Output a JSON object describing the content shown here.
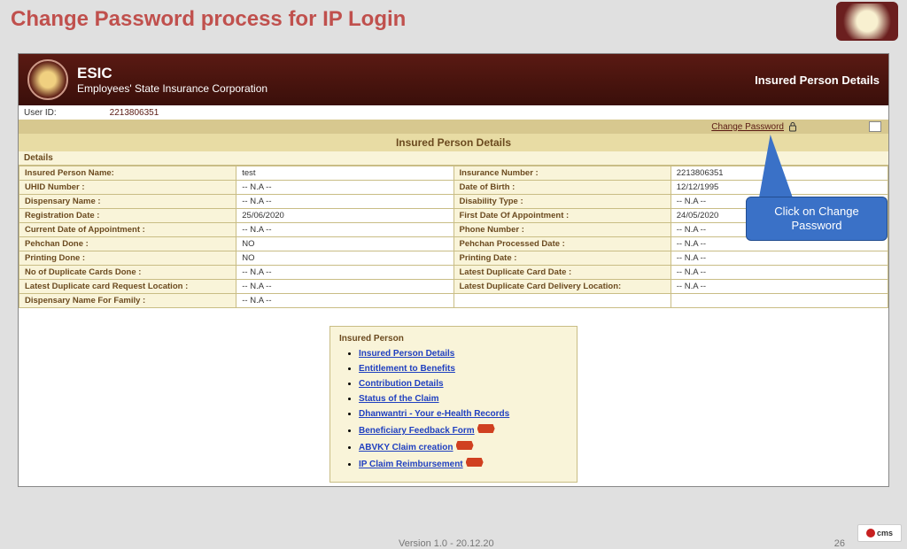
{
  "slide": {
    "title": "Change Password process for IP Login",
    "version": "Version 1.0 - 20.12.20",
    "page": "26",
    "footer_logo": "cms"
  },
  "callout": "Click on Change Password",
  "app": {
    "title1": "ESIC",
    "title2": "Employees' State Insurance Corporation",
    "header_right": "Insured Person Details",
    "userid_label": "User ID:",
    "userid_value": "2213806351",
    "change_pw": "Change Password",
    "section_title": "Insured Person Details",
    "details_label": "Details",
    "rows": [
      [
        "Insured Person Name:",
        "test",
        "Insurance Number :",
        "2213806351"
      ],
      [
        "UHID Number :",
        "-- N.A --",
        "Date of Birth :",
        "12/12/1995"
      ],
      [
        "Dispensary Name :",
        "-- N.A --",
        "Disability Type :",
        "-- N.A --"
      ],
      [
        "Registration Date :",
        "25/06/2020",
        "First Date Of Appointment :",
        "24/05/2020"
      ],
      [
        "Current Date of Appointment :",
        "-- N.A --",
        "Phone Number :",
        "-- N.A --"
      ],
      [
        "Pehchan Done :",
        "NO",
        "Pehchan Processed Date :",
        "-- N.A --"
      ],
      [
        "Printing Done :",
        "NO",
        "Printing Date :",
        "-- N.A --"
      ],
      [
        "No of Duplicate Cards Done :",
        "-- N.A --",
        "Latest Duplicate Card Date :",
        "-- N.A --"
      ],
      [
        "Latest Duplicate card Request Location :",
        "-- N.A --",
        "Latest Duplicate Card Delivery Location:",
        "-- N.A --"
      ],
      [
        "Dispensary Name For Family :",
        "-- N.A --",
        "",
        ""
      ]
    ],
    "links_title": "Insured Person",
    "links": [
      {
        "label": "Insured Person Details",
        "new": false
      },
      {
        "label": "Entitlement to Benefits",
        "new": false
      },
      {
        "label": "Contribution Details",
        "new": false
      },
      {
        "label": "Status of the Claim",
        "new": false
      },
      {
        "label": "Dhanwantri - Your e-Health Records",
        "new": false
      },
      {
        "label": "Beneficiary Feedback Form",
        "new": true
      },
      {
        "label": "ABVKY Claim creation",
        "new": true
      },
      {
        "label": "IP Claim Reimbursement",
        "new": true
      }
    ]
  }
}
